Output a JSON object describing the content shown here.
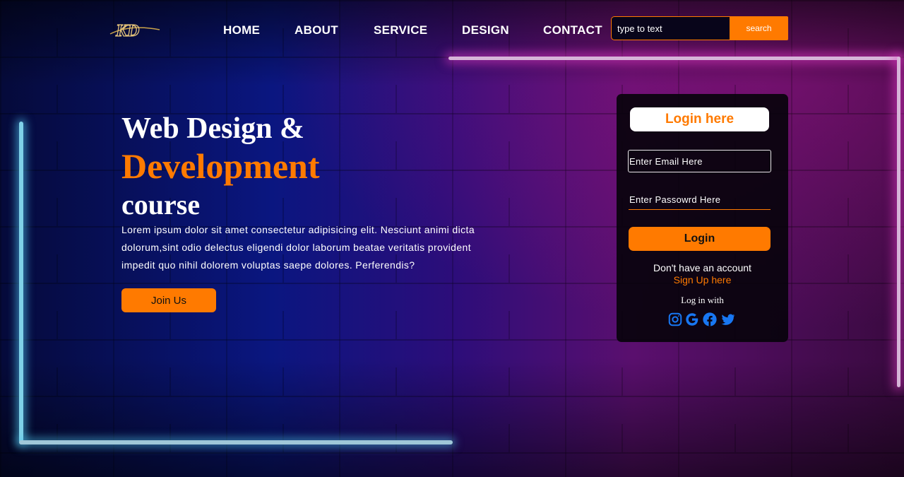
{
  "brand": {
    "logo_text": "KD"
  },
  "nav": {
    "items": [
      {
        "label": "HOME"
      },
      {
        "label": "ABOUT"
      },
      {
        "label": "SERVICE"
      },
      {
        "label": "DESIGN"
      },
      {
        "label": "CONTACT"
      }
    ]
  },
  "search": {
    "placeholder": "type to text",
    "button_label": "search"
  },
  "hero": {
    "line1": "Web Design &",
    "line2": "Development",
    "line3": "course",
    "text": "Lorem ipsum dolor sit amet consectetur adipisicing elit. Nesciunt animi dicta dolorum,sint odio delectus eligendi dolor laborum beatae veritatis provident impedit quo nihil dolorem voluptas saepe dolores. Perferendis?",
    "join_label": "Join Us"
  },
  "login": {
    "title": "Login here",
    "email_placeholder": "Enter Email Here",
    "password_placeholder": "Enter Passowrd Here",
    "button_label": "Login",
    "no_account_text": "Don't have an account",
    "signup_label": "Sign Up here",
    "login_with_text": "Log in with",
    "social_icons": [
      "instagram-icon",
      "google-icon",
      "facebook-icon",
      "twitter-icon"
    ]
  },
  "colors": {
    "accent": "#ff7a00",
    "social_blue": "#1877f2"
  }
}
